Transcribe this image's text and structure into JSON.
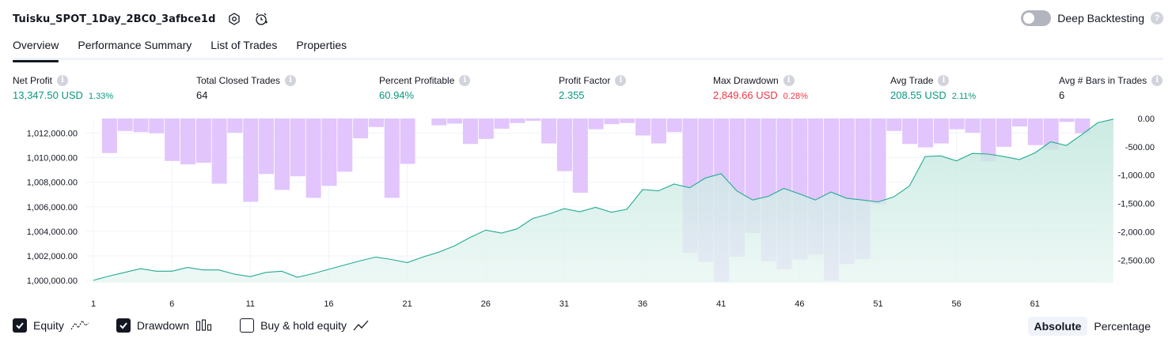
{
  "header": {
    "title": "Tuisku_SPOT_1Day_2BC0_3afbce1d",
    "settings_icon": "gear-hex-icon",
    "alert_icon": "alarm-clock-plus-icon"
  },
  "deep_backtesting": {
    "label": "Deep Backtesting",
    "enabled": false,
    "help": "?"
  },
  "tabs": [
    {
      "label": "Overview",
      "active": true
    },
    {
      "label": "Performance Summary"
    },
    {
      "label": "List of Trades"
    },
    {
      "label": "Properties"
    }
  ],
  "stats": {
    "net_profit": {
      "label": "Net Profit",
      "value": "13,347.50 USD",
      "pct": "1.33%"
    },
    "total_closed_trades": {
      "label": "Total Closed Trades",
      "value": "64"
    },
    "percent_profitable": {
      "label": "Percent Profitable",
      "value": "60.94%"
    },
    "profit_factor": {
      "label": "Profit Factor",
      "value": "2.355"
    },
    "max_drawdown": {
      "label": "Max Drawdown",
      "value": "2,849.66 USD",
      "pct": "0.28%"
    },
    "avg_trade": {
      "label": "Avg Trade",
      "value": "208.55 USD",
      "pct": "2.11%"
    },
    "avg_bars": {
      "label": "Avg # Bars in Trades",
      "value": "6"
    }
  },
  "legend": {
    "equity": {
      "label": "Equity",
      "checked": true
    },
    "drawdown": {
      "label": "Drawdown",
      "checked": true
    },
    "buy_hold": {
      "label": "Buy & hold equity",
      "checked": false
    }
  },
  "scale": {
    "absolute": "Absolute",
    "percentage": "Percentage",
    "selected": "Absolute"
  },
  "colors": {
    "equity_line": "#22ab94",
    "equity_fill": "#d5f0e8",
    "drawdown_bar": "#e1c5fc",
    "profit_green": "#089981",
    "loss_red": "#f23645"
  },
  "chart_data": {
    "type": "line",
    "x_ticks": [
      "1",
      "6",
      "11",
      "16",
      "21",
      "26",
      "31",
      "36",
      "41",
      "46",
      "51",
      "56",
      "61"
    ],
    "left_axis": {
      "ticks": [
        "1,000,000.00",
        "1,002,000.00",
        "1,004,000.00",
        "1,006,000.00",
        "1,008,000.00",
        "1,010,000.00",
        "1,012,000.00"
      ],
      "ylim": [
        999800,
        1013200
      ]
    },
    "right_axis": {
      "ticks": [
        "0.00",
        "-500.00",
        "-1,000.00",
        "-1,500.00",
        "-2,000.00",
        "-2,500.00"
      ],
      "ylim": [
        -2900,
        0
      ]
    },
    "series": [
      {
        "name": "Equity",
        "type": "area",
        "values": [
          1000000,
          1000350,
          1000650,
          1000950,
          1000750,
          1000750,
          1001050,
          1000850,
          1000850,
          1000500,
          1000300,
          1000650,
          1000750,
          1000250,
          1000550,
          1000900,
          1001250,
          1001600,
          1001900,
          1001700,
          1001450,
          1001900,
          1002300,
          1002800,
          1003500,
          1004100,
          1003850,
          1004200,
          1005050,
          1005400,
          1005850,
          1005600,
          1005950,
          1005550,
          1005800,
          1007400,
          1007300,
          1007850,
          1007550,
          1008350,
          1008700,
          1007300,
          1006550,
          1006850,
          1007500,
          1007050,
          1006550,
          1007200,
          1006700,
          1006550,
          1006400,
          1006800,
          1007700,
          1010100,
          1010150,
          1009750,
          1010350,
          1010300,
          1010100,
          1009850,
          1010400,
          1011300,
          1011000,
          1011900,
          1012850,
          1013150
        ]
      },
      {
        "name": "Drawdown",
        "type": "bar",
        "values": [
          0,
          -610,
          -220,
          -240,
          -260,
          -750,
          -810,
          -780,
          -1150,
          -250,
          -1470,
          -980,
          -1260,
          -1020,
          -1400,
          -1190,
          -940,
          -350,
          -150,
          -1400,
          -800,
          0,
          -120,
          -90,
          -450,
          -360,
          -180,
          -80,
          -40,
          -440,
          -930,
          -1310,
          -190,
          -100,
          -80,
          -300,
          -440,
          -240,
          -2370,
          -2530,
          -2880,
          -2440,
          -2020,
          -2520,
          -2660,
          -2490,
          -2400,
          -2860,
          -2570,
          -2480,
          -1520,
          -220,
          -450,
          -510,
          -440,
          -190,
          -250,
          -760,
          -500,
          -140,
          -470,
          -550,
          -60,
          -260,
          0
        ]
      }
    ]
  }
}
